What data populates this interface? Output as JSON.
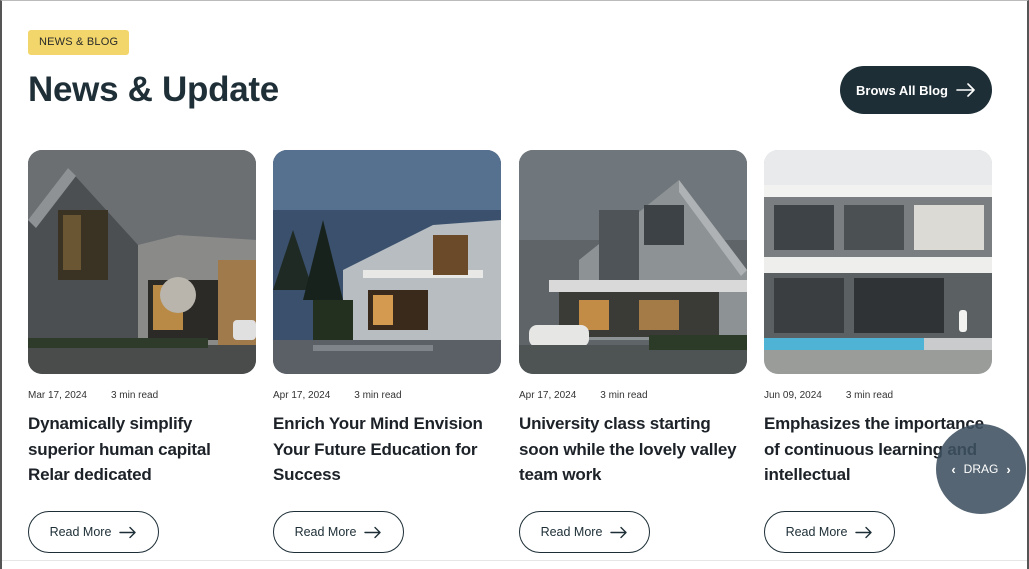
{
  "section": {
    "tag": "NEWS & BLOG",
    "title": "News & Update",
    "browse_label": "Brows All Blog"
  },
  "posts": [
    {
      "date": "Mar 17, 2024",
      "read_time": "3 min read",
      "title": "Dynamically simplify superior human capital Relar dedicated",
      "button": "Read More"
    },
    {
      "date": "Apr 17, 2024",
      "read_time": "3 min read",
      "title": "Enrich Your Mind Envision Your Future Education for Success",
      "button": "Read More"
    },
    {
      "date": "Apr 17, 2024",
      "read_time": "3 min read",
      "title": "University class starting soon while the lovely valley team work",
      "button": "Read More"
    },
    {
      "date": "Jun 09, 2024",
      "read_time": "3 min read",
      "title": "Emphasizes the importance of continuous learning and intellectual",
      "button": "Read More"
    }
  ],
  "drag": {
    "label": "DRAG"
  },
  "icons": {
    "arrow": "arrow-right-icon",
    "prev": "chevron-left-icon",
    "next": "chevron-right-icon"
  },
  "colors": {
    "accent": "#f2d66b",
    "dark": "#1d2e36",
    "drag_bg": "#3e5060"
  }
}
